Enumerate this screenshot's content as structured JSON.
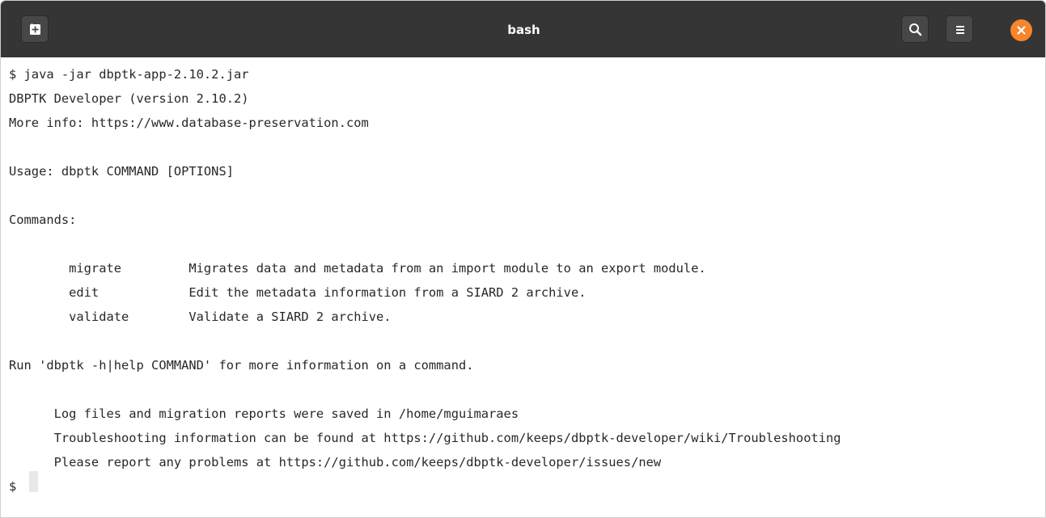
{
  "window": {
    "title": "bash",
    "icons": {
      "new_tab": "new-tab-icon",
      "search": "search-icon",
      "menu": "hamburger-menu-icon",
      "close": "close-icon"
    },
    "colors": {
      "titlebar": "#353535",
      "close_button": "#f6852c",
      "terminal_background": "#ffffff",
      "terminal_text": "#282828"
    }
  },
  "terminal": {
    "lines": [
      "$ java -jar dbptk-app-2.10.2.jar",
      "DBPTK Developer (version 2.10.2)",
      "More info: https://www.database-preservation.com",
      "",
      "Usage: dbptk COMMAND [OPTIONS]",
      "",
      "Commands:",
      "",
      "        migrate         Migrates data and metadata from an import module to an export module.",
      "        edit            Edit the metadata information from a SIARD 2 archive.",
      "        validate        Validate a SIARD 2 archive.",
      "",
      "Run 'dbptk -h|help COMMAND' for more information on a command.",
      "",
      "      Log files and migration reports were saved in /home/mguimaraes",
      "      Troubleshooting information can be found at https://github.com/keeps/dbptk-developer/wiki/Troubleshooting",
      "      Please report any problems at https://github.com/keeps/dbptk-developer/issues/new",
      "$"
    ]
  }
}
